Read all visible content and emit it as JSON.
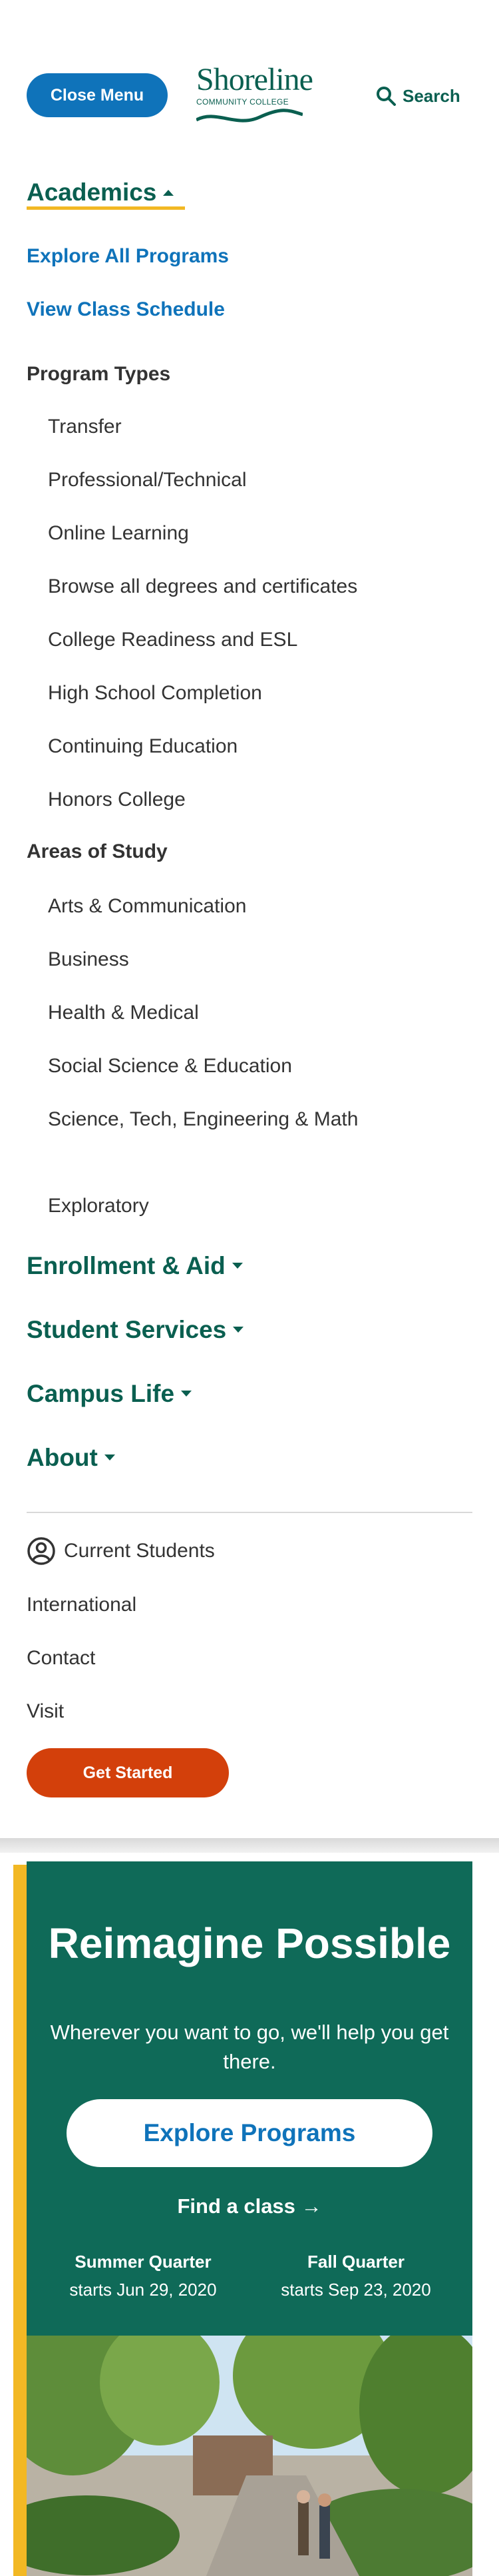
{
  "header": {
    "menu_button": "Close Menu",
    "logo_word": "Shoreline",
    "logo_sub": "COMMUNITY COLLEGE",
    "search_label": "Search"
  },
  "nav": {
    "academics": {
      "label": "Academics",
      "links": [
        "Explore All Programs",
        "View Class Schedule"
      ],
      "program_types_heading": "Program Types",
      "program_types": [
        "Transfer",
        "Professional/Technical",
        "Online Learning",
        "Browse all degrees and certificates",
        "College Readiness and ESL",
        "High School Completion",
        "Continuing Education",
        "Honors College"
      ],
      "areas_heading": "Areas of Study",
      "areas": [
        "Arts & Communication",
        "Business",
        "Health & Medical",
        "Social Science & Education",
        "Science, Tech, Engineering & Math",
        "Exploratory"
      ]
    },
    "sections": [
      "Enrollment & Aid",
      "Student Services",
      "Campus Life",
      "About"
    ],
    "utility": [
      "Current Students",
      "International",
      "Contact",
      "Visit"
    ],
    "cta": "Get Started"
  },
  "hero": {
    "title": "Reimagine Possible",
    "tagline": "Wherever you want to go, we'll help you get there.",
    "button": "Explore Programs",
    "find_class": "Find a class →",
    "quarters": [
      {
        "name": "Summer Quarter",
        "date": "starts Jun 29, 2020"
      },
      {
        "name": "Fall Quarter",
        "date": "starts Sep 23, 2020"
      }
    ]
  },
  "colors": {
    "brand_green": "#0f6a58",
    "link_blue": "#0f73ba",
    "accent_yellow": "#f2b824",
    "cta_orange": "#d3400b"
  }
}
